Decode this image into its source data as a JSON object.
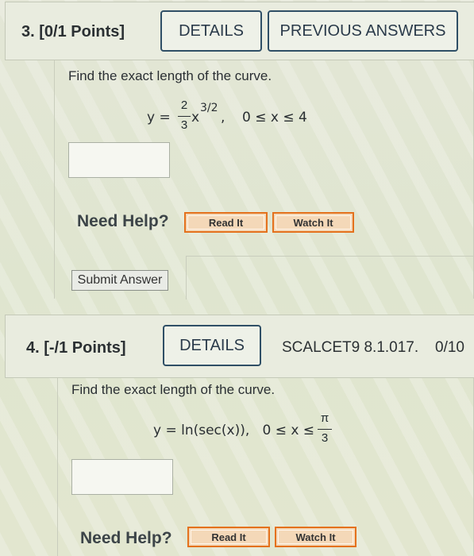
{
  "q3": {
    "number": "3. [0/1 Points]",
    "details": "DETAILS",
    "previous": "PREVIOUS ANSWERS",
    "prompt": "Find the exact length of the curve.",
    "eq_lhs": "y =",
    "frac_num": "2",
    "frac_den": "3",
    "eq_power": "x",
    "eq_exp": "3/2",
    "eq_range": ",    0 ≤ x ≤ 4",
    "answer_value": "",
    "need_help": "Need Help?",
    "read_it": "Read It",
    "watch_it": "Watch It",
    "submit": "Submit Answer"
  },
  "q4": {
    "number": "4. [-/1 Points]",
    "details": "DETAILS",
    "source": "SCALCET9 8.1.017.",
    "attempts": "0/10",
    "prompt": "Find the exact length of the curve.",
    "eq_main": "y = ln(sec(x)),   0 ≤ x ≤",
    "frac_num": "π",
    "frac_den": "3",
    "answer_value": "",
    "need_help": "Need Help?",
    "read_it": "Read It",
    "watch_it": "Watch It"
  }
}
